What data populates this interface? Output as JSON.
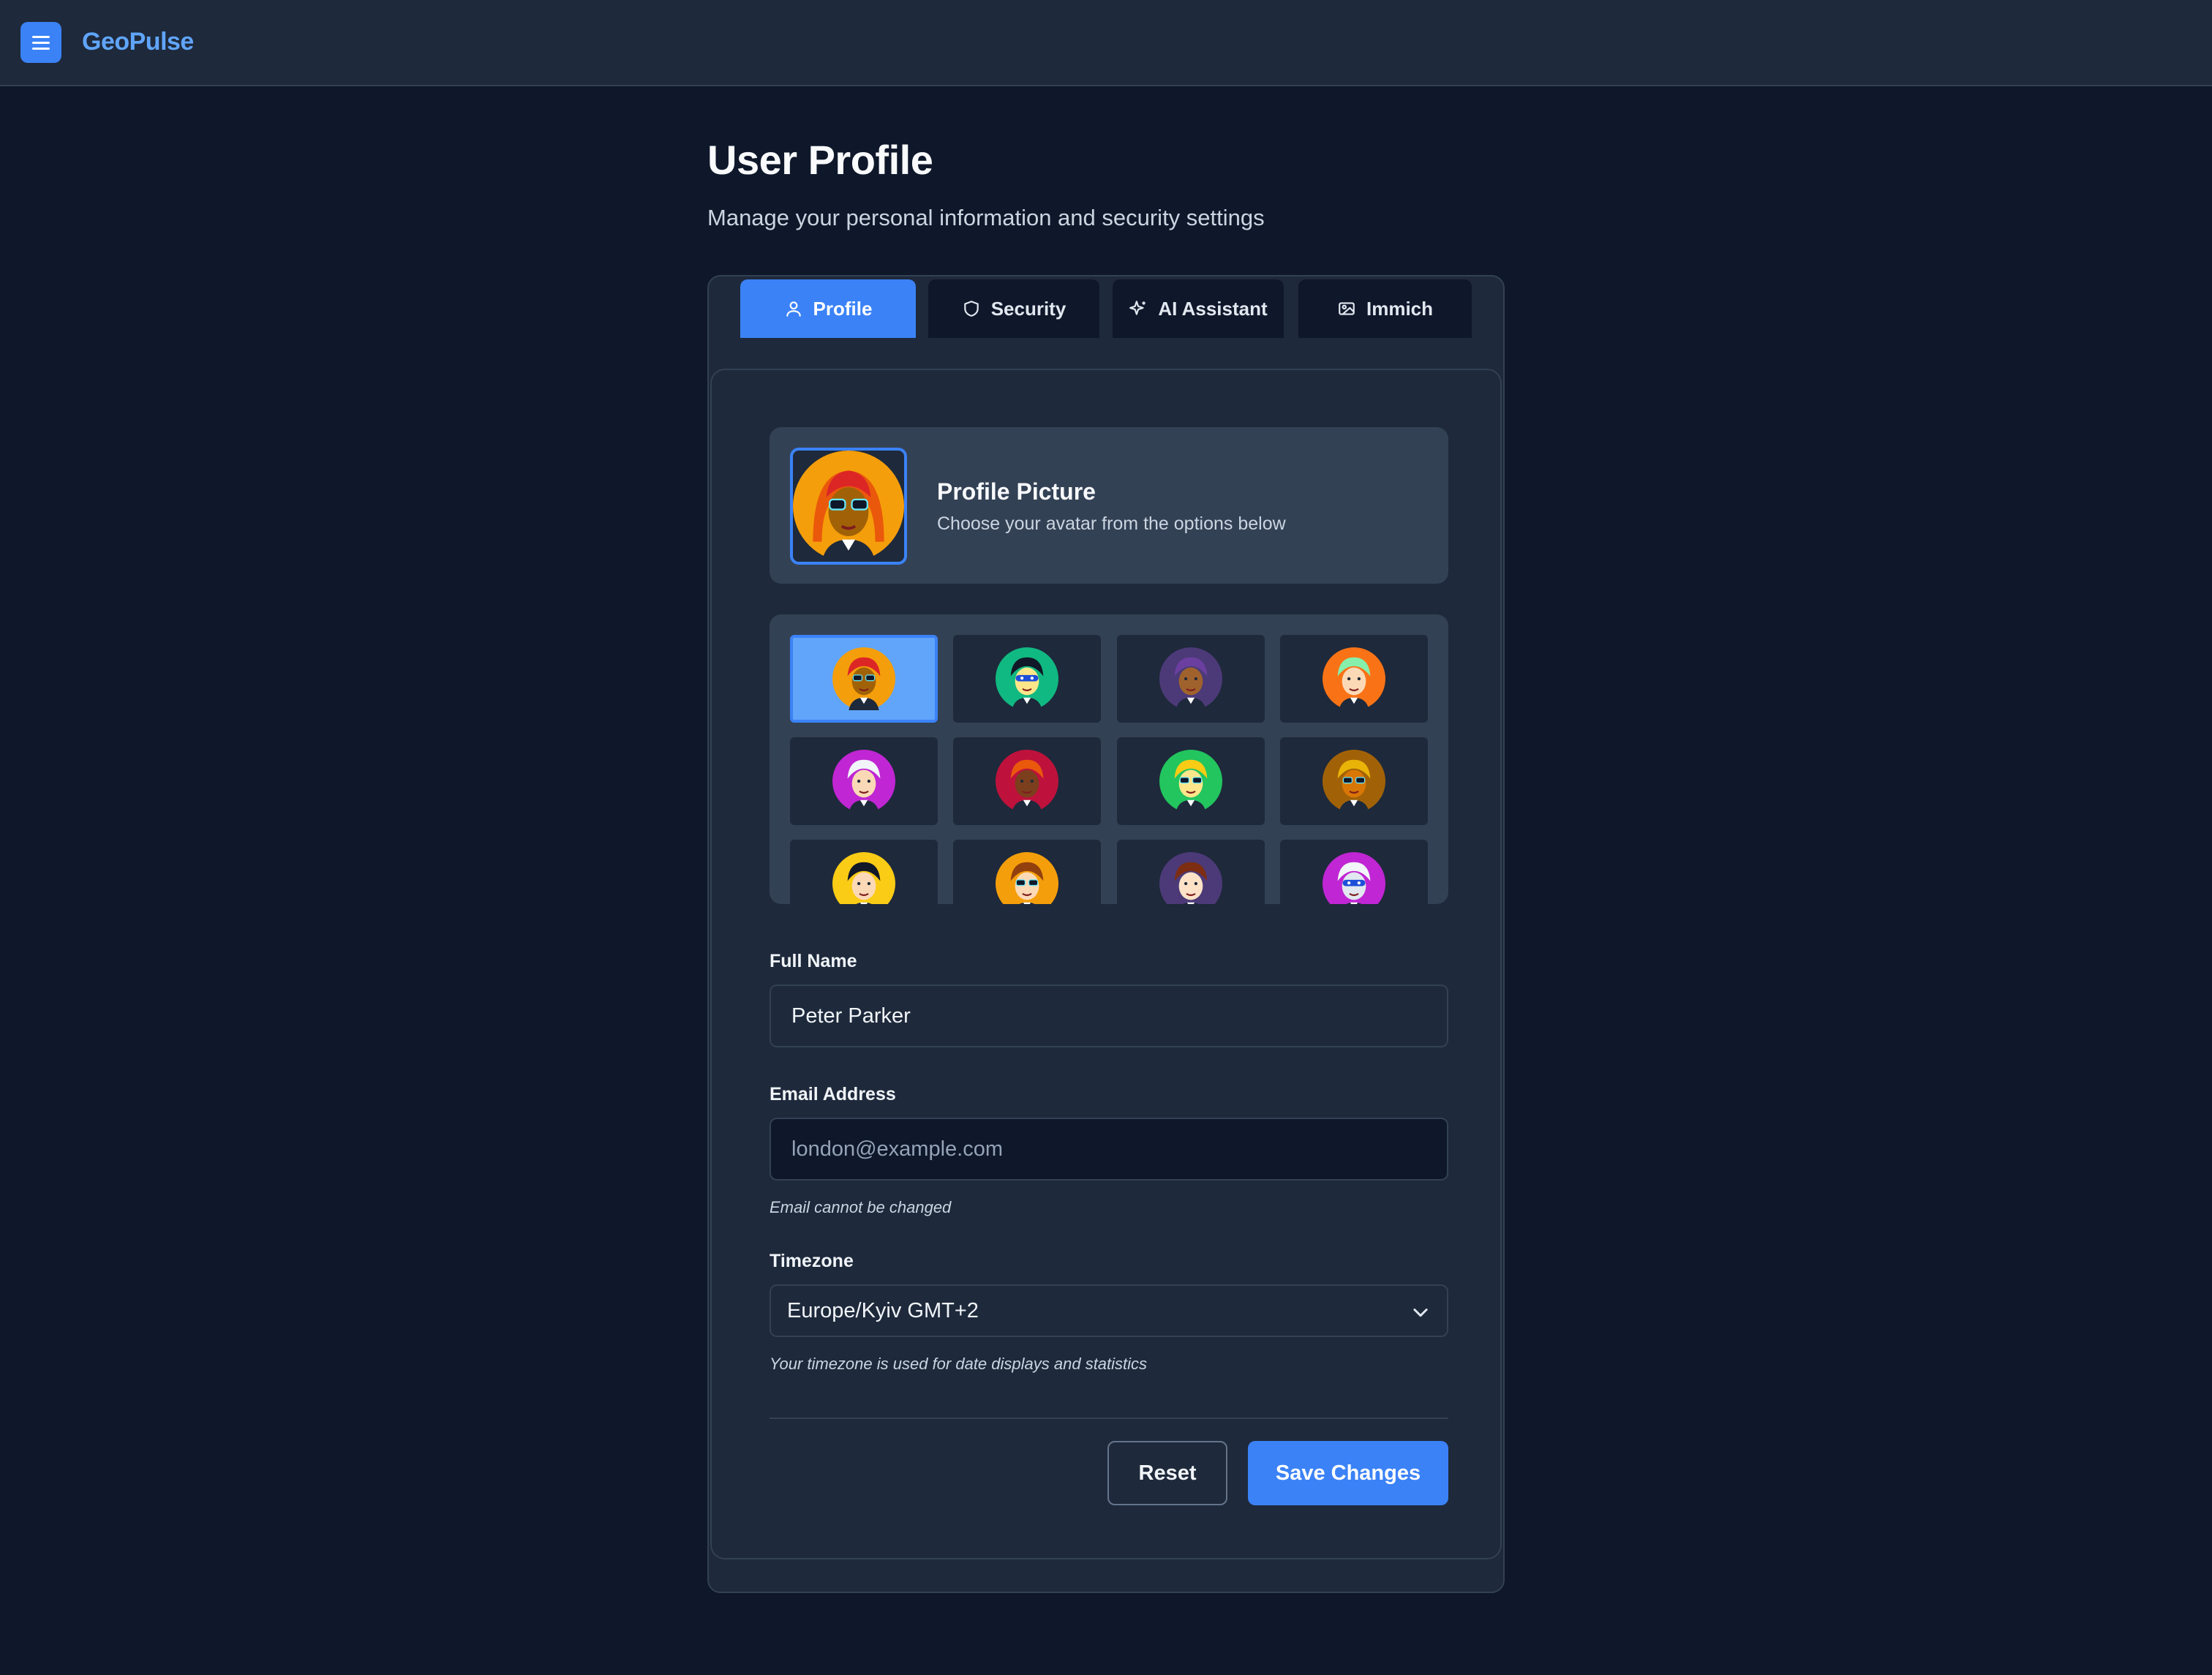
{
  "app": {
    "brand": "GeoPulse",
    "menu_icon": "hamburger-menu-icon",
    "accent_color": "#3b82f6"
  },
  "header": {
    "title": "User Profile",
    "subtitle": "Manage your personal information and security settings"
  },
  "tabs": [
    {
      "label": "Profile",
      "icon": "user-icon",
      "active": true
    },
    {
      "label": "Security",
      "icon": "shield-icon",
      "active": false
    },
    {
      "label": "AI Assistant",
      "icon": "sparkles-icon",
      "active": false
    },
    {
      "label": "Immich",
      "icon": "image-icon",
      "active": false
    }
  ],
  "profile_picture": {
    "title": "Profile Picture",
    "description": "Choose your avatar from the options below",
    "selected_index": 0
  },
  "avatars": [
    {
      "name": "avatar-1",
      "bg": "#f59e0b",
      "hair": "#dc2626",
      "skin": "#a16207",
      "glasses": true,
      "selected": true
    },
    {
      "name": "avatar-2",
      "bg": "#10b981",
      "hair": "#111827",
      "skin": "#fde68a",
      "mask": "#1d4ed8"
    },
    {
      "name": "avatar-3",
      "bg": "#4c3a78",
      "hair": "#6b3fa0",
      "skin": "#a0622d"
    },
    {
      "name": "avatar-4",
      "bg": "#f97316",
      "hair": "#86efac",
      "skin": "#fcd9b6"
    },
    {
      "name": "avatar-5",
      "bg": "#c026d3",
      "hair": "#f1f5f9",
      "skin": "#fcd9b6"
    },
    {
      "name": "avatar-6",
      "bg": "#be123c",
      "hair": "#ea580c",
      "skin": "#7c3f1d"
    },
    {
      "name": "avatar-7",
      "bg": "#22c55e",
      "hair": "#facc15",
      "skin": "#fde68a",
      "glasses": true
    },
    {
      "name": "avatar-8",
      "bg": "#a16207",
      "hair": "#eab308",
      "skin": "#d97706",
      "glasses": true
    },
    {
      "name": "avatar-9",
      "bg": "#facc15",
      "hair": "#111827",
      "skin": "#fcd9b6"
    },
    {
      "name": "avatar-10",
      "bg": "#f59e0b",
      "hair": "#92400e",
      "skin": "#fcd9b6",
      "glasses": true
    },
    {
      "name": "avatar-11",
      "bg": "#4c3a78",
      "hair": "#7c2d12",
      "skin": "#fde2c8"
    },
    {
      "name": "avatar-12",
      "bg": "#c026d3",
      "hair": "#f1f5f9",
      "skin": "#e2e8f0",
      "mask": "#1d4ed8"
    }
  ],
  "form": {
    "full_name_label": "Full Name",
    "full_name_value": "Peter Parker",
    "email_label": "Email Address",
    "email_value": "london@example.com",
    "email_hint": "Email cannot be changed",
    "timezone_label": "Timezone",
    "timezone_value": "Europe/Kyiv GMT+2",
    "timezone_hint": "Your timezone is used for date displays and statistics"
  },
  "actions": {
    "reset_label": "Reset",
    "save_label": "Save Changes"
  }
}
